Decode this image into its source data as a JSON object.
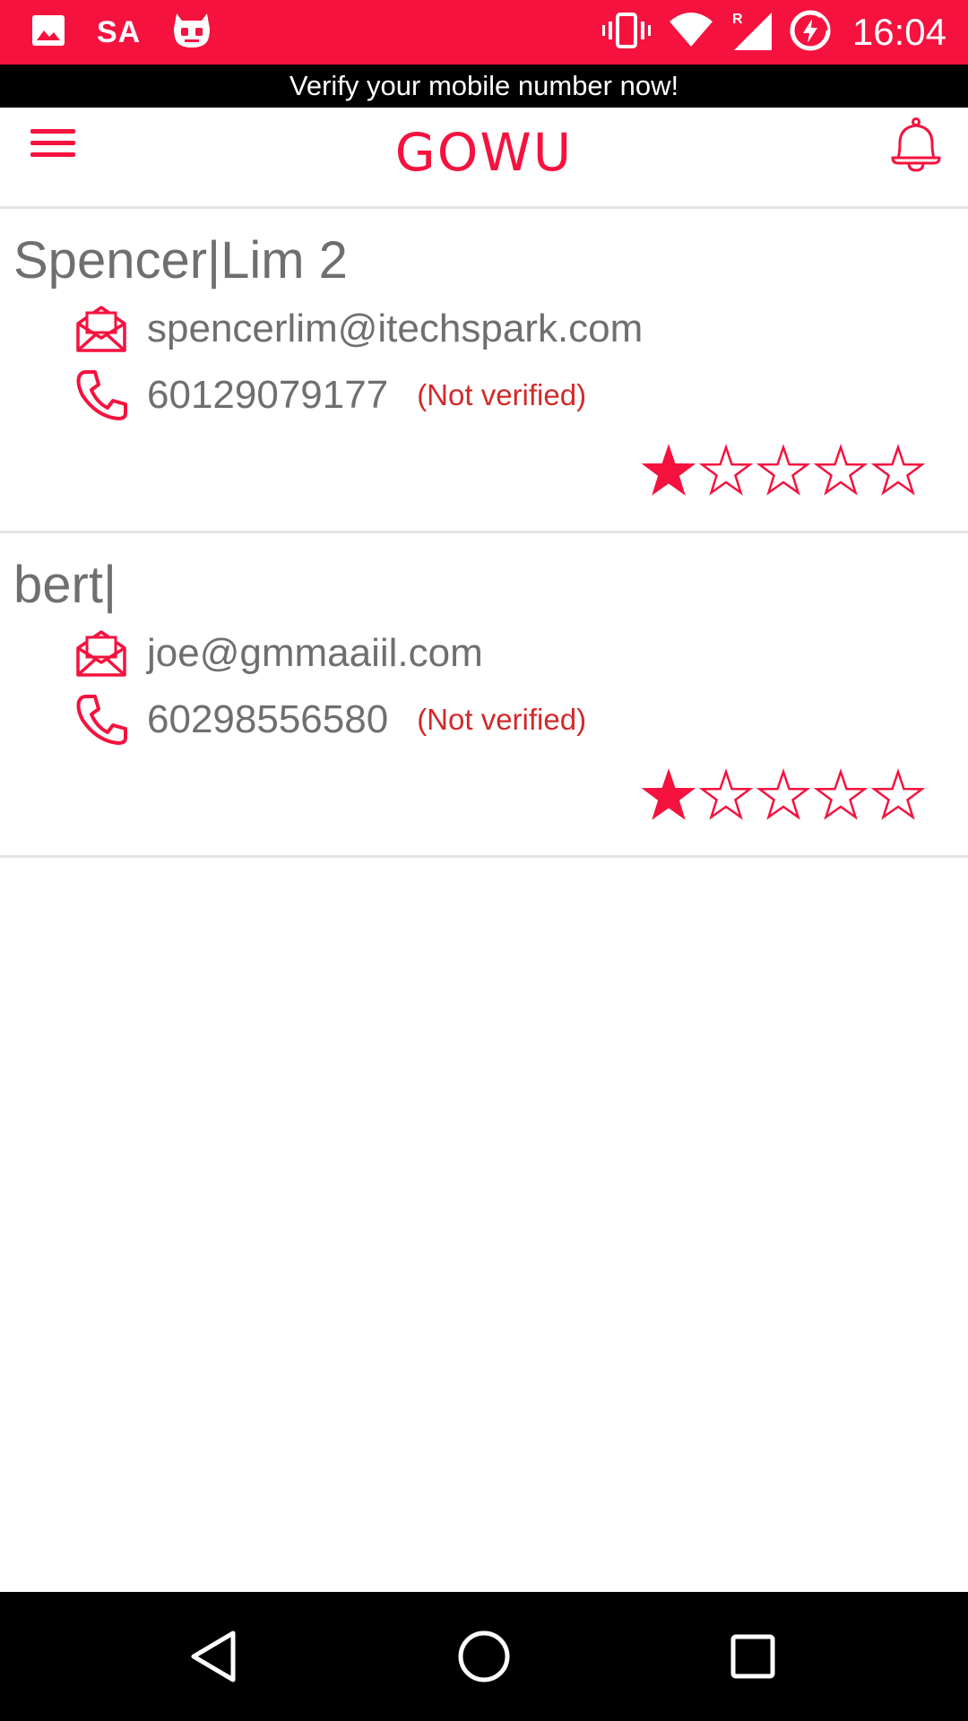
{
  "status_bar": {
    "carrier_text": "SA",
    "time": "16:04",
    "background_color": "#f5123e",
    "icons": [
      "image-icon",
      "cyanogen-icon",
      "vibrate-icon",
      "wifi-icon",
      "signal-roaming-icon",
      "battery-charging-icon"
    ]
  },
  "banner": {
    "text": "Verify your mobile number now!"
  },
  "app_bar": {
    "title": "GOWU",
    "accent_color": "#f5123e",
    "icons": [
      "hamburger-menu-icon",
      "bell-icon"
    ]
  },
  "contacts": [
    {
      "name": "Spencer|Lim 2",
      "email": "spencerlim@itechspark.com",
      "phone": "60129079177",
      "phone_status": "(Not verified)",
      "rating": 1,
      "rating_max": 5
    },
    {
      "name": "bert|",
      "email": "joe@gmmaaiil.com",
      "phone": "60298556580",
      "phone_status": "(Not verified)",
      "rating": 1,
      "rating_max": 5
    }
  ],
  "nav_bar": {
    "icons": [
      "back-icon",
      "home-icon",
      "recents-icon"
    ]
  }
}
